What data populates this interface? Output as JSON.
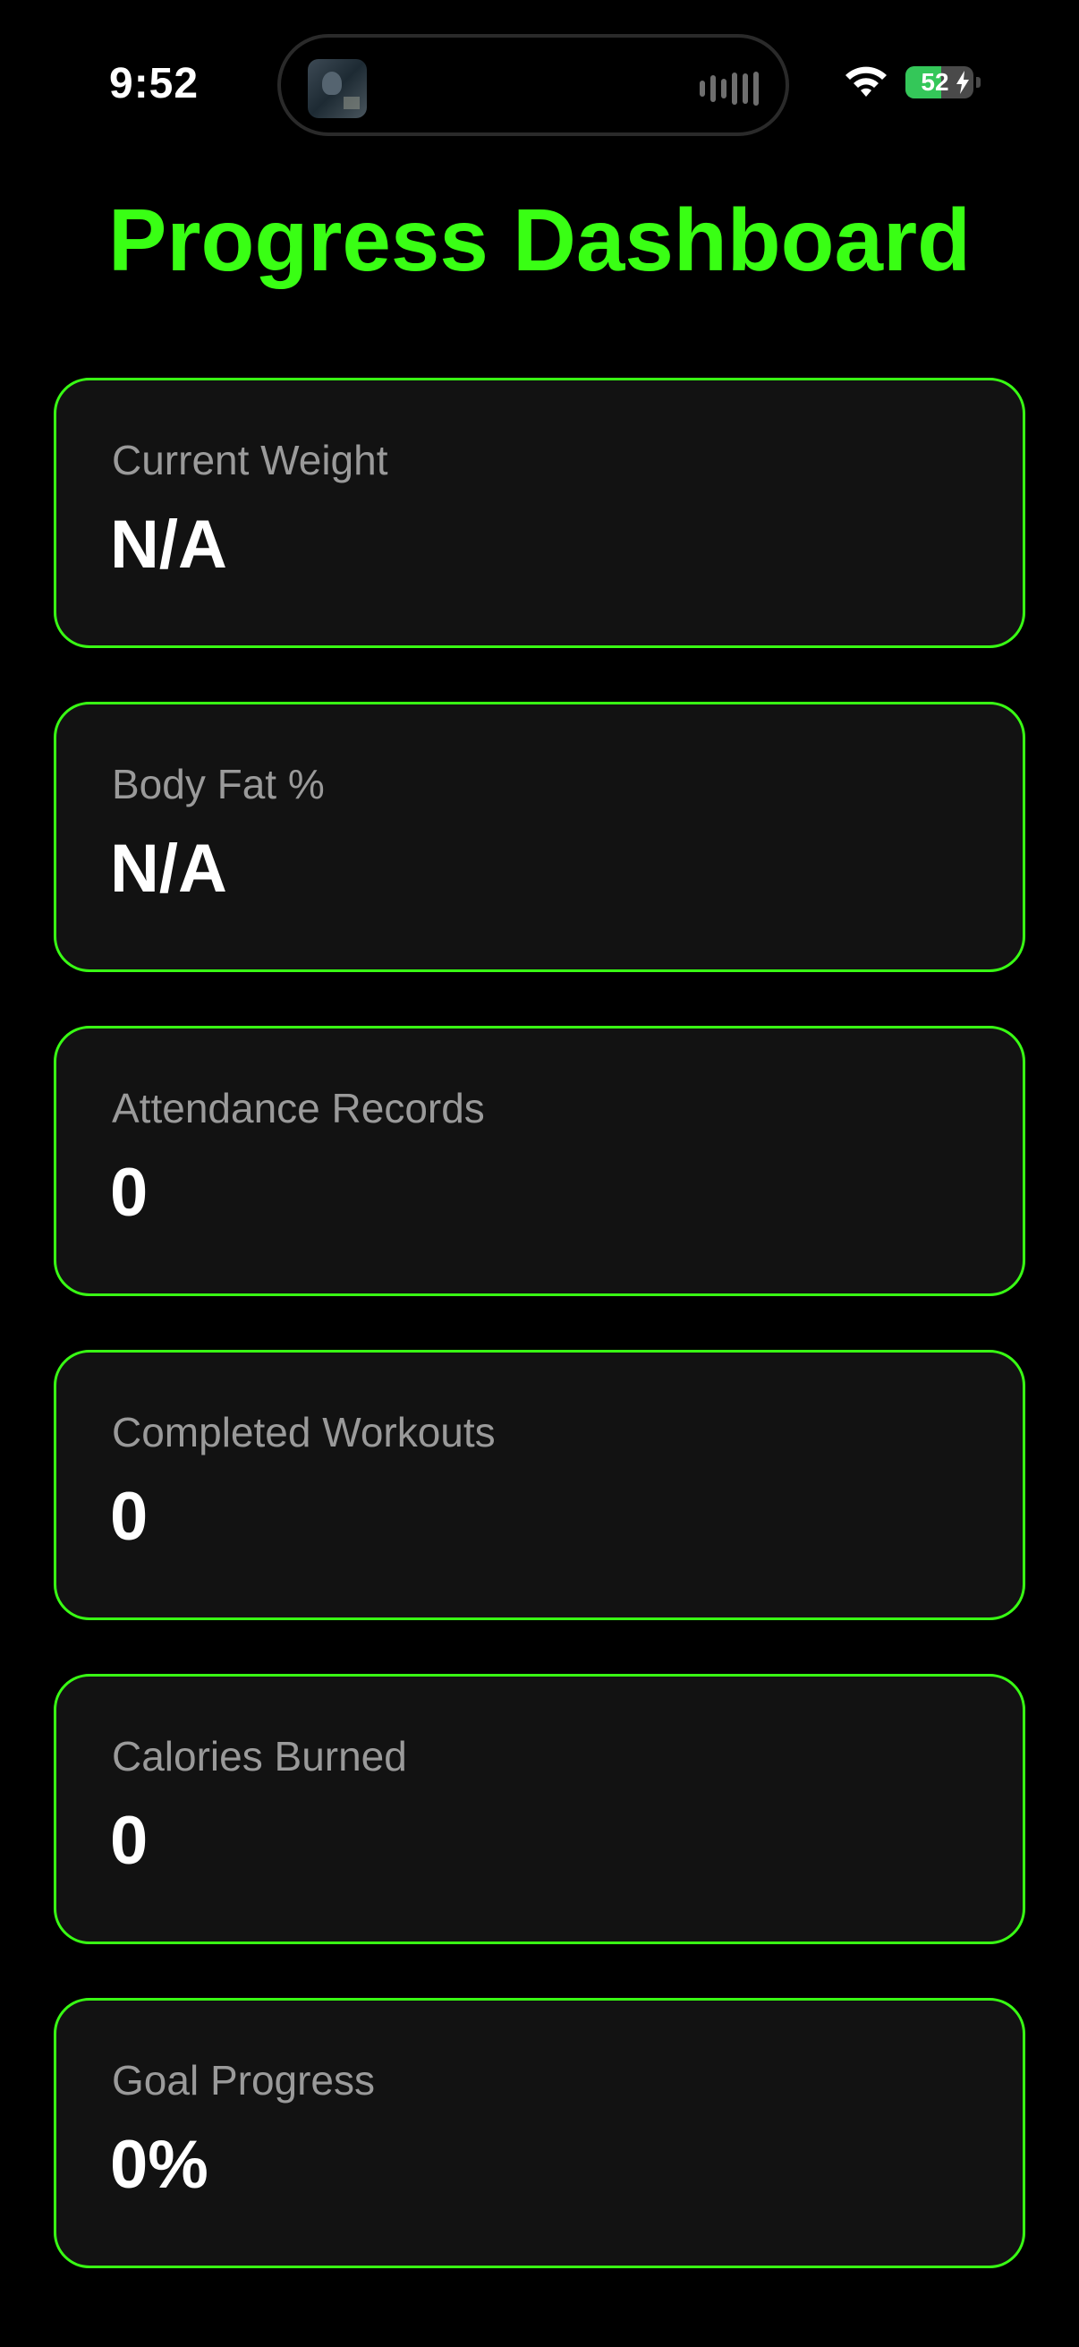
{
  "status_bar": {
    "time": "9:52",
    "battery_percent": "52",
    "battery_level": 0.52,
    "charging": true,
    "wifi_icon": "wifi-icon",
    "now_playing_icon": "album-art",
    "activity_icon": "waveform-icon"
  },
  "colors": {
    "accent": "#39ff14",
    "background": "#000000",
    "card_background": "#121212",
    "label": "#9a9a9a",
    "value": "#ffffff",
    "battery_green": "#34c759"
  },
  "header": {
    "title": "Progress Dashboard"
  },
  "cards": [
    {
      "label": "Current Weight",
      "value": "N/A"
    },
    {
      "label": "Body Fat %",
      "value": "N/A"
    },
    {
      "label": "Attendance Records",
      "value": "0"
    },
    {
      "label": "Completed Workouts",
      "value": "0"
    },
    {
      "label": "Calories Burned",
      "value": "0"
    },
    {
      "label": "Goal Progress",
      "value": "0%"
    }
  ]
}
